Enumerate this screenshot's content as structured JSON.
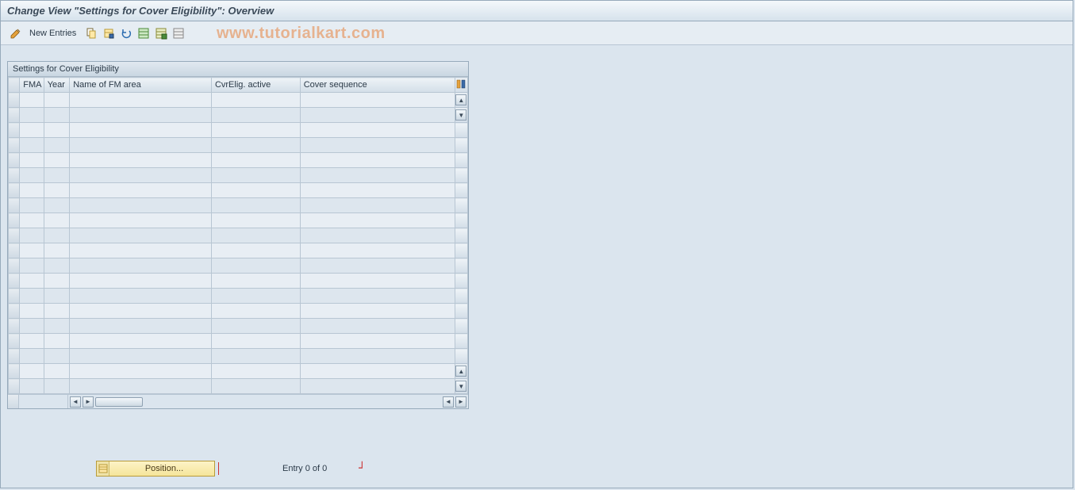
{
  "title": "Change View \"Settings for Cover Eligibility\": Overview",
  "toolbar": {
    "new_entries_label": "New Entries"
  },
  "watermark": "www.tutorialkart.com",
  "panel": {
    "title": "Settings for Cover Eligibility",
    "columns": {
      "fma": "FMA",
      "year": "Year",
      "name": "Name of FM area",
      "cvrelig": "CvrElig. active",
      "coverseq": "Cover sequence"
    },
    "row_count": 20
  },
  "footer": {
    "position_label": "Position...",
    "entry_text": "Entry 0 of 0"
  }
}
